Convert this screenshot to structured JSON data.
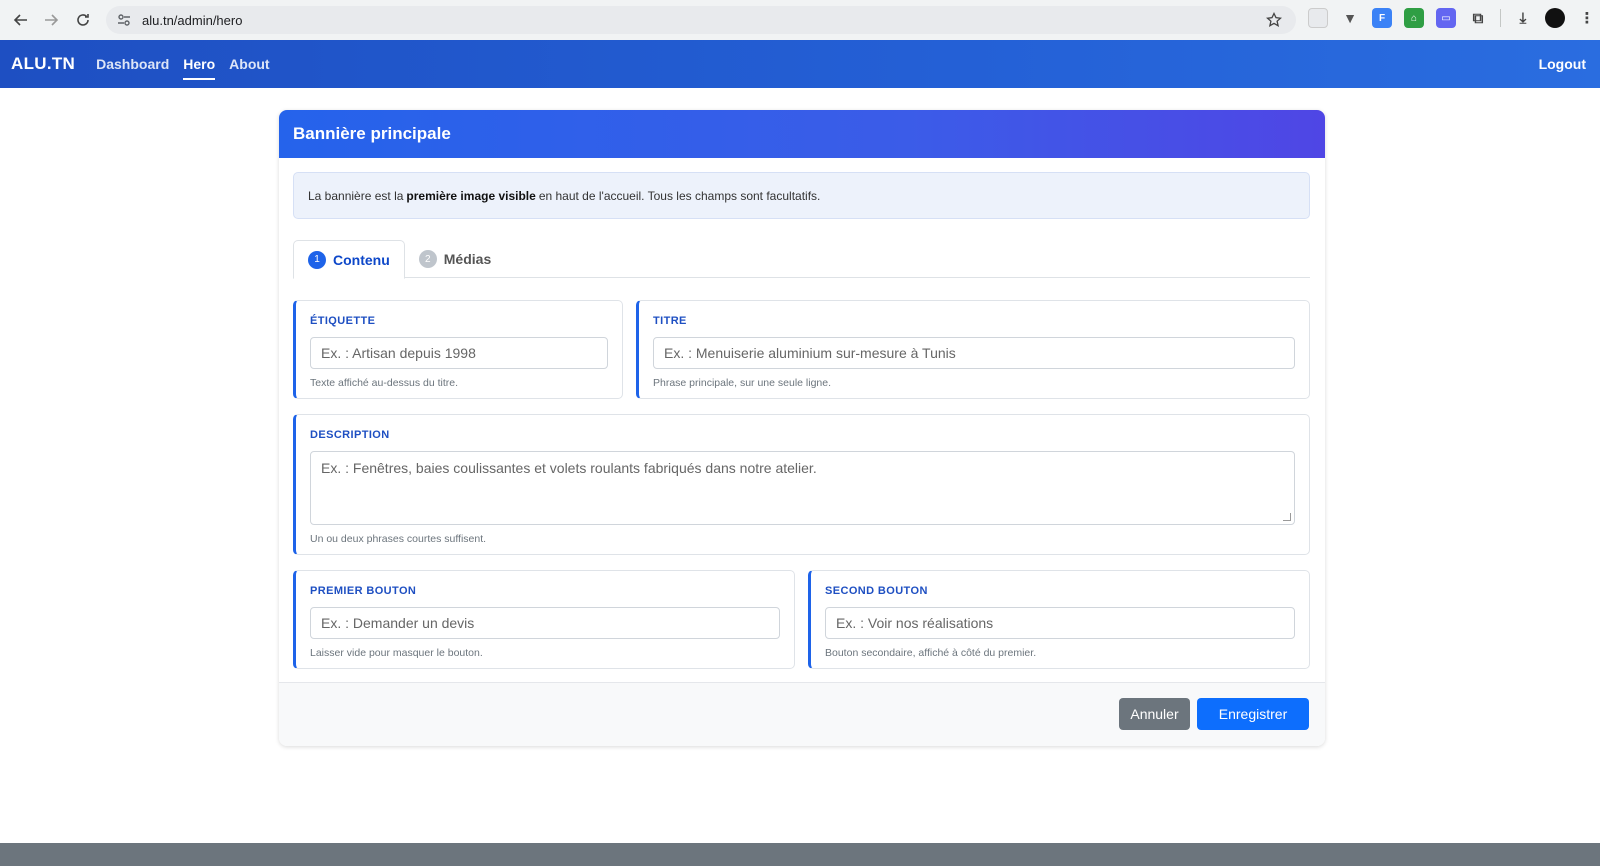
{
  "browser": {
    "url": "alu.tn/admin/hero"
  },
  "navbar": {
    "brand": "ALU.TN",
    "links": [
      "Dashboard",
      "Hero",
      "About"
    ],
    "logout": "Logout"
  },
  "card": {
    "title": "Bannière principale",
    "info": {
      "before": "La bannière est la",
      "strong": "première image visible",
      "after": "en haut de l'accueil. Tous les champs sont facultatifs."
    },
    "tabs": [
      {
        "num": "1",
        "label": "Contenu"
      },
      {
        "num": "2",
        "label": "Médias"
      }
    ],
    "fields": {
      "etiquette": {
        "label": "ÉTIQUETTE",
        "placeholder": "Ex. : Artisan depuis 1998",
        "help": "Texte affiché au-dessus du titre."
      },
      "titre": {
        "label": "TITRE",
        "placeholder": "Ex. : Menuiserie aluminium sur-mesure à Tunis",
        "help": "Phrase principale, sur une seule ligne."
      },
      "description": {
        "label": "DESCRIPTION",
        "placeholder": "Ex. : Fenêtres, baies coulissantes et volets roulants fabriqués dans notre atelier.",
        "help": "Un ou deux phrases courtes suffisent."
      },
      "premier": {
        "label": "PREMIER BOUTON",
        "placeholder": "Ex. : Demander un devis",
        "help": "Laisser vide pour masquer le bouton."
      },
      "second": {
        "label": "SECOND BOUTON",
        "placeholder": "Ex. : Voir nos réalisations",
        "help": "Bouton secondaire, affiché à côté du premier."
      }
    },
    "buttons": {
      "cancel": "Annuler",
      "save": "Enregistrer"
    }
  }
}
